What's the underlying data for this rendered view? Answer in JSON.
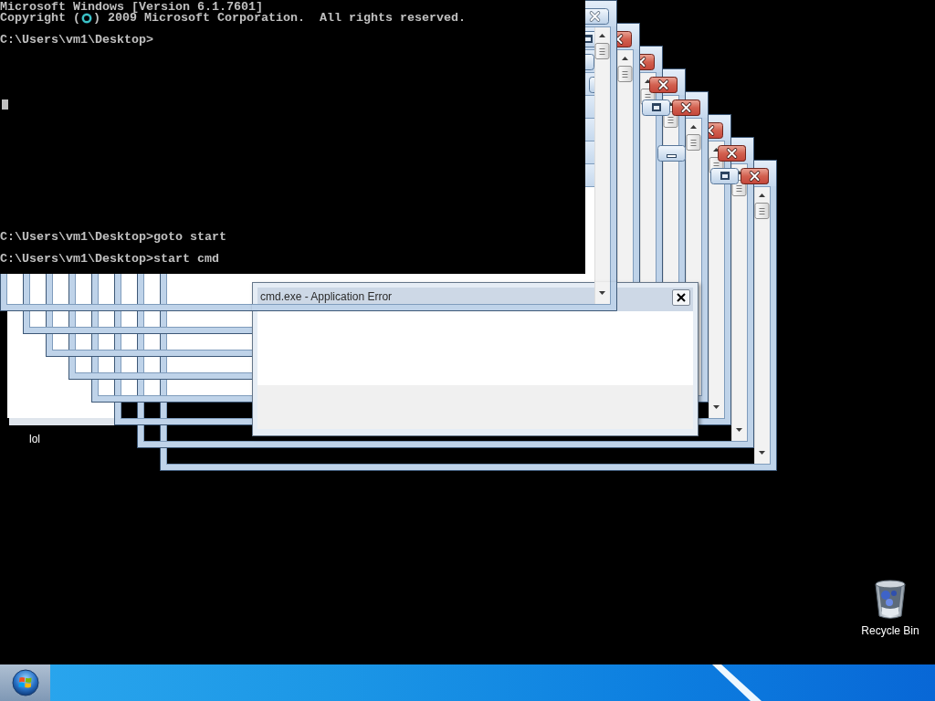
{
  "console": {
    "banner": "Microsoft Windows [Version 6.1.7601]",
    "copyright_before_cursor": "Copyright (",
    "copyright_after_cursor": ") 2009 Microsoft Corporation.  All rights reserved.",
    "prompt": "C:\\Users\\vm1\\Desktop>",
    "commands": [
      "C:\\Users\\vm1\\Desktop>goto start",
      "C:\\Users\\vm1\\Desktop>start cmd"
    ]
  },
  "error_dialog": {
    "title": "cmd.exe - Application Error"
  },
  "desktop_icons": [
    {
      "kind": "covered",
      "label": "lol"
    },
    {
      "kind": "recycle_bin",
      "label": "Recycle Bin"
    }
  ]
}
